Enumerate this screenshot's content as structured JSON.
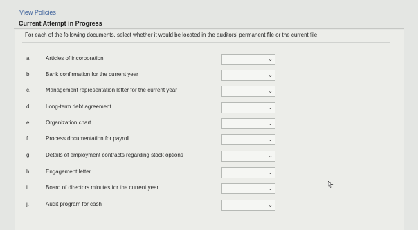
{
  "header": {
    "view_policies": "View Policies",
    "attempt_status": "Current Attempt in Progress"
  },
  "question": {
    "instructions": "For each of the following documents, select whether it would be located in the auditors' permanent file or the current file."
  },
  "items": [
    {
      "letter": "a.",
      "text": "Articles of incorporation",
      "value": ""
    },
    {
      "letter": "b.",
      "text": "Bank confirmation for the current year",
      "value": ""
    },
    {
      "letter": "c.",
      "text": "Management representation letter for the current year",
      "value": ""
    },
    {
      "letter": "d.",
      "text": "Long-term debt agreement",
      "value": ""
    },
    {
      "letter": "e.",
      "text": "Organization chart",
      "value": ""
    },
    {
      "letter": "f.",
      "text": "Process documentation for payroll",
      "value": ""
    },
    {
      "letter": "g.",
      "text": "Details of employment contracts regarding stock options",
      "value": ""
    },
    {
      "letter": "h.",
      "text": "Engagement letter",
      "value": ""
    },
    {
      "letter": "i.",
      "text": "Board of directors minutes for the current year",
      "value": ""
    },
    {
      "letter": "j.",
      "text": "Audit program for cash",
      "value": ""
    }
  ],
  "icons": {
    "dropdown": "chevron-down-icon",
    "pointer": "mouse-pointer-icon"
  },
  "colors": {
    "link": "#3a5f9a",
    "background": "#e4e6e3"
  }
}
